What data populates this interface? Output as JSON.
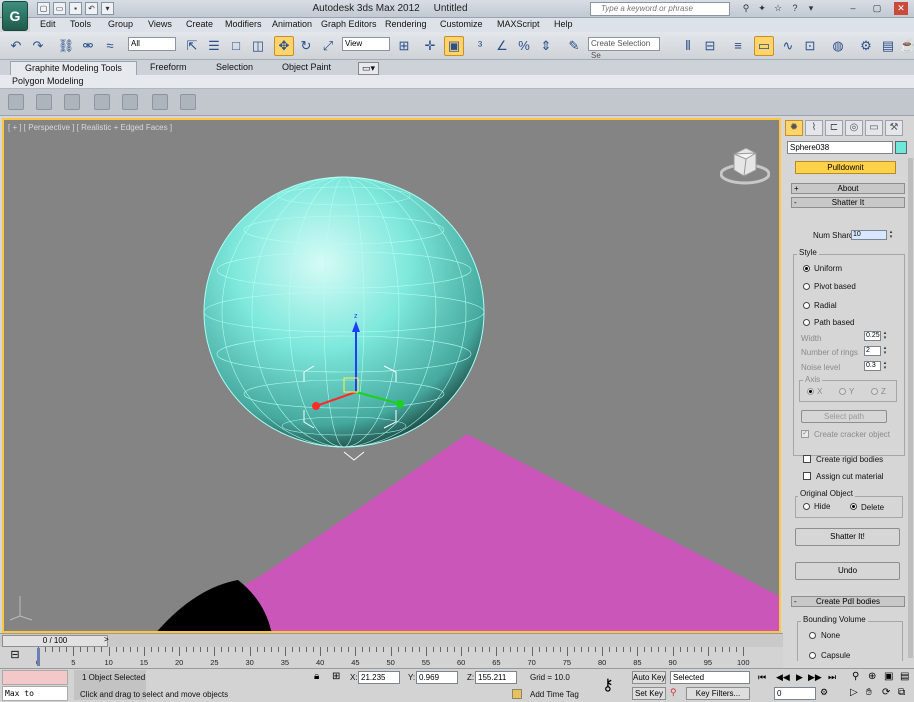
{
  "title_bar": {
    "app_name": "Autodesk 3ds Max  2012",
    "file_name": "Untitled",
    "search_placeholder": "Type a keyword or phrase"
  },
  "menu": [
    "Edit",
    "Tools",
    "Group",
    "Views",
    "Create",
    "Modifiers",
    "Animation",
    "Graph Editors",
    "Rendering",
    "Customize",
    "MAXScript",
    "Help"
  ],
  "toolbar": {
    "selection_filter": "All",
    "reference_coord": "View",
    "selection_set_placeholder": "Create Selection Se"
  },
  "ribbon": {
    "tabs": [
      "Graphite Modeling Tools",
      "Freeform",
      "Selection",
      "Object Paint"
    ],
    "sub_tab": "Polygon Modeling"
  },
  "viewport": {
    "label": "[ + ] [ Perspective ] [ Realistic + Edged Faces ]"
  },
  "command_panel": {
    "object_name": "Sphere038",
    "object_color": "#6ee8d8",
    "pulldown_label": "Pulldownit",
    "about_rollout": "About",
    "shatter_rollout": "Shatter It",
    "num_shards_label": "Num Shards:",
    "num_shards_value": "10",
    "style_group": "Style",
    "style_options": [
      "Uniform",
      "Pivot based",
      "Radial",
      "Path based"
    ],
    "style_selected": "Uniform",
    "width_label": "Width",
    "width_value": "0.25",
    "rings_label": "Number of rings",
    "rings_value": "2",
    "noise_label": "Noise level",
    "noise_value": "0.3",
    "axis_group": "Axis",
    "axis_options": [
      "X",
      "Y",
      "Z"
    ],
    "select_path_label": "Select path",
    "create_cracker_label": "Create cracker object",
    "create_rigid_label": "Create rigid bodies",
    "assign_cut_label": "Assign cut material",
    "original_group": "Original Object",
    "original_options": [
      "Hide",
      "Delete"
    ],
    "original_selected": "Delete",
    "shatter_button": "Shatter It!",
    "undo_button": "Undo",
    "pdi_rollout": "Create PdI bodies",
    "bounding_group": "Bounding Volume",
    "bounding_options": [
      "None",
      "Capsule"
    ]
  },
  "time": {
    "slider_label": "0 / 100",
    "frame_current": 0,
    "frame_total": 100,
    "ticks": [
      0,
      5,
      10,
      15,
      20,
      25,
      30,
      35,
      40,
      45,
      50,
      55,
      60,
      65,
      70,
      75,
      80,
      85,
      90,
      95,
      100
    ]
  },
  "status": {
    "listener_text": "Max to Physc.",
    "selection_info": "1 Object Selected",
    "prompt": "Click and drag to select and move objects",
    "x_label": "X:",
    "x_value": "21.235",
    "y_label": "Y:",
    "y_value": "0.969",
    "z_label": "Z:",
    "z_value": "155.211",
    "grid": "Grid = 10.0",
    "add_time_tag": "Add Time Tag",
    "auto_key": "Auto Key",
    "set_key": "Set Key",
    "key_mode": "Selected",
    "key_filters": "Key Filters...",
    "frame_field": "0"
  },
  "colors": {
    "sphere": "#7ee8dc",
    "plane": "#c956b8",
    "viewport_bg": "#848484",
    "active_accent": "#ffc83c"
  }
}
